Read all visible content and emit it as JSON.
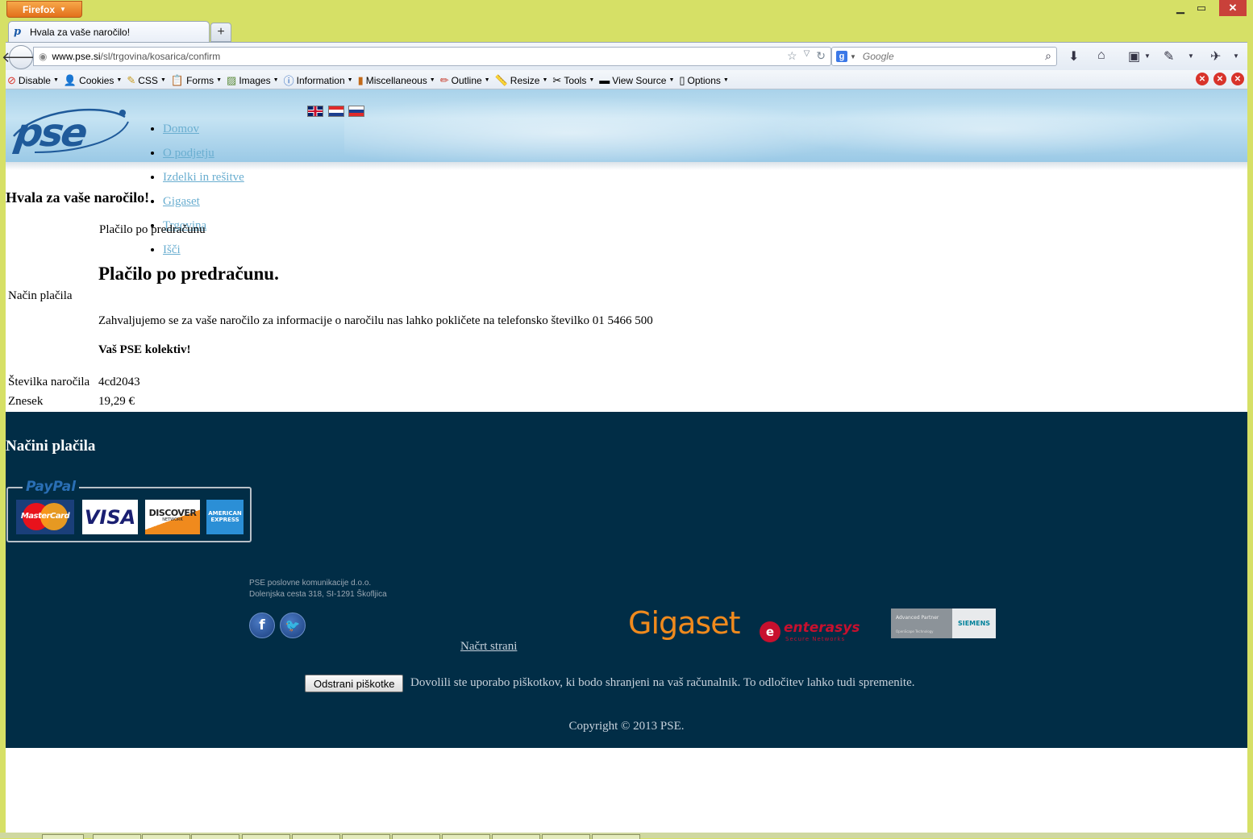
{
  "browser": {
    "menu_button": "Firefox",
    "tab_title": "Hvala za vaše naročilo!",
    "url_domain": "www.pse.si",
    "url_path": "/sl/trgovina/kosarica/confirm",
    "search_placeholder": "Google",
    "devbar": [
      "Disable",
      "Cookies",
      "CSS",
      "Forms",
      "Images",
      "Information",
      "Miscellaneous",
      "Outline",
      "Resize",
      "Tools",
      "View Source",
      "Options"
    ]
  },
  "site": {
    "logo": "pse",
    "nav": [
      "Domov",
      "O podjetju",
      "Izdelki in rešitve",
      "Gigaset",
      "Trgovina",
      "Išči"
    ]
  },
  "order": {
    "page_title": "Hvala za vaše naročilo!",
    "payment_method_value": "Plačilo po predračunu",
    "payment_method_label": "Način plačila",
    "payment_heading": "Plačilo po predračunu.",
    "thanks_message": "Zahvaljujemo se za vaše naročilo za informacije o naročilu nas lahko pokličete na telefonsko številko 01 5466 500",
    "team_sign": "Vaš PSE kolektiv!",
    "order_number_label": "Številka naročila",
    "order_number_value": "4cd2043",
    "amount_label": "Znesek",
    "amount_value": "19,29 €"
  },
  "footer": {
    "methods_heading": "Načini plačila",
    "paypal": "PayPal",
    "cards": {
      "mastercard": "MasterCard",
      "visa": "VISA",
      "discover": "DISCOVER",
      "discover_sub": "NETWORK",
      "amex_top": "AMERICAN",
      "amex_bottom": "EXPRESS"
    },
    "company_name": "PSE poslovne komunikacije d.o.o.",
    "company_address": "Dolenjska cesta 318, SI-1291 Škofljica",
    "sitemap": "Načrt strani",
    "partners": {
      "gigaset": "Gigaset",
      "enterasys": "enterasys",
      "enterasys_sub": "Secure Networks",
      "siemens_l1": "Advanced Partner",
      "siemens_l2": "OpenScape Technology",
      "siemens": "SIEMENS"
    },
    "cookie_button": "Odstrani piškotke",
    "cookie_text": "Dovolili ste uporabo piškotkov, ki bodo shranjeni na vaš računalnik. To odločitev lahko tudi spremenite.",
    "copyright": "Copyright © 2013 PSE."
  }
}
